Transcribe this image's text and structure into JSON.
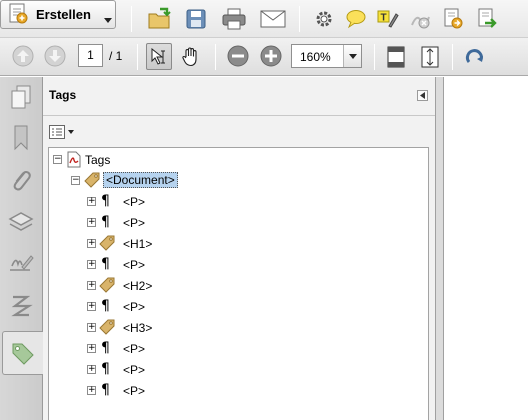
{
  "toolbar_top": {
    "create_label": "Erstellen",
    "icons": [
      "open-folder-icon",
      "save-icon",
      "print-icon",
      "email-icon",
      "settings-icon",
      "comment-icon",
      "highlight-icon",
      "sign-icon",
      "export-icon",
      "share-icon"
    ]
  },
  "toolbar_nav": {
    "page_number": "1",
    "page_count": "/ 1",
    "zoom": "160%"
  },
  "left_rail": {
    "items": [
      "pages-icon",
      "bookmarks-icon",
      "attachments-icon",
      "layers-icon",
      "signatures-icon",
      "model-tree-icon",
      "tags-icon"
    ],
    "active": "tags-icon"
  },
  "tags_panel": {
    "title": "Tags",
    "tree": {
      "root": "Tags",
      "document": "<Document>",
      "children": [
        "<P>",
        "<P>",
        "<H1>",
        "<P>",
        "<H2>",
        "<P>",
        "<H3>",
        "<P>",
        "<P>",
        "<P>"
      ]
    }
  },
  "colors": {
    "selection": "#b6d3ef",
    "panel_bg": "#f2f2f2",
    "rail_bg": "#d0d0d0"
  }
}
